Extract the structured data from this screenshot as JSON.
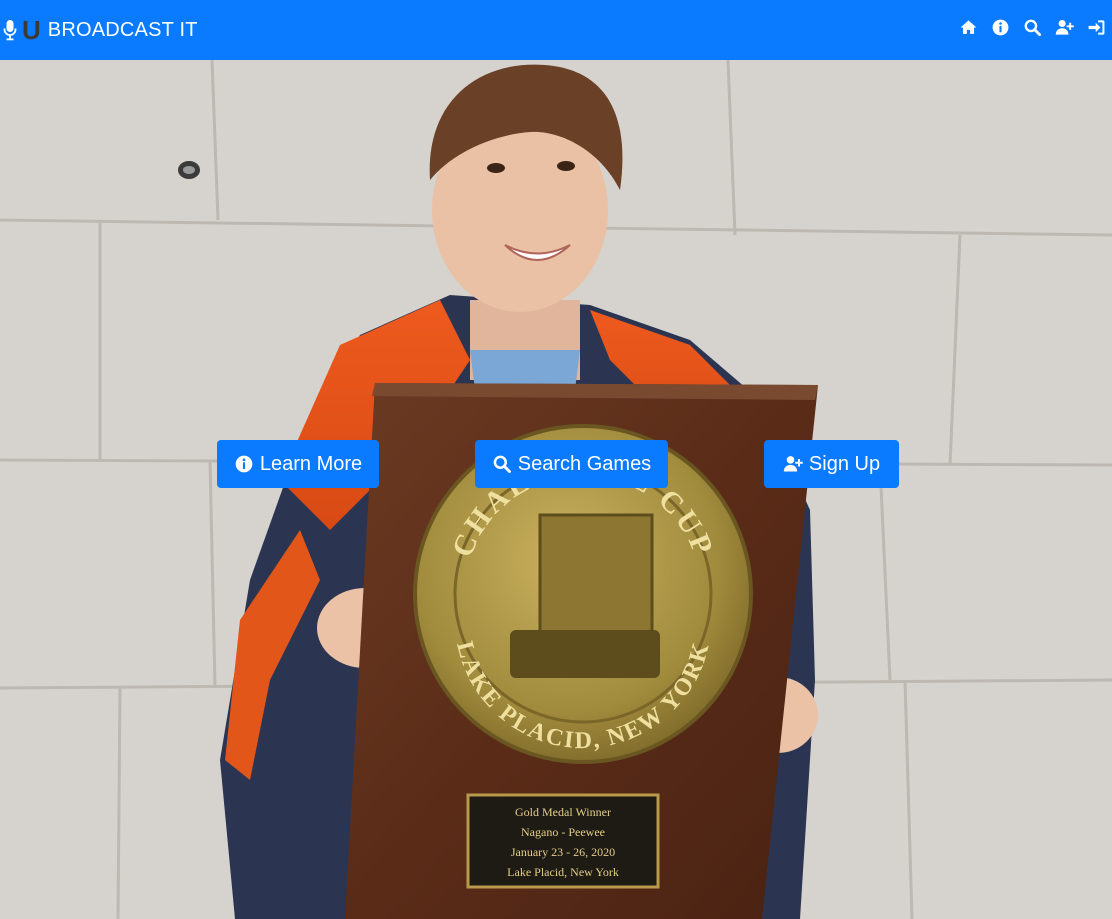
{
  "navbar": {
    "brand_letter": "U",
    "brand_text": "BROADCAST IT",
    "icons": [
      "home-icon",
      "info-icon",
      "search-icon",
      "user-plus-icon",
      "sign-in-icon"
    ],
    "accent_color": "#0a7bff"
  },
  "hero": {
    "buttons": [
      {
        "label": "Learn More",
        "icon": "info-icon"
      },
      {
        "label": "Search Games",
        "icon": "search-icon"
      },
      {
        "label": "Sign Up",
        "icon": "user-plus-icon"
      }
    ],
    "plaque": {
      "medallion_top_text": "CHALLENGE CUP",
      "medallion_bottom_text": "LAKE PLACID, NEW YORK",
      "plate_lines": [
        "Gold Medal Winner",
        "Nagano - Peewee",
        "January 23 - 26, 2020",
        "Lake Placid, New York"
      ]
    }
  }
}
